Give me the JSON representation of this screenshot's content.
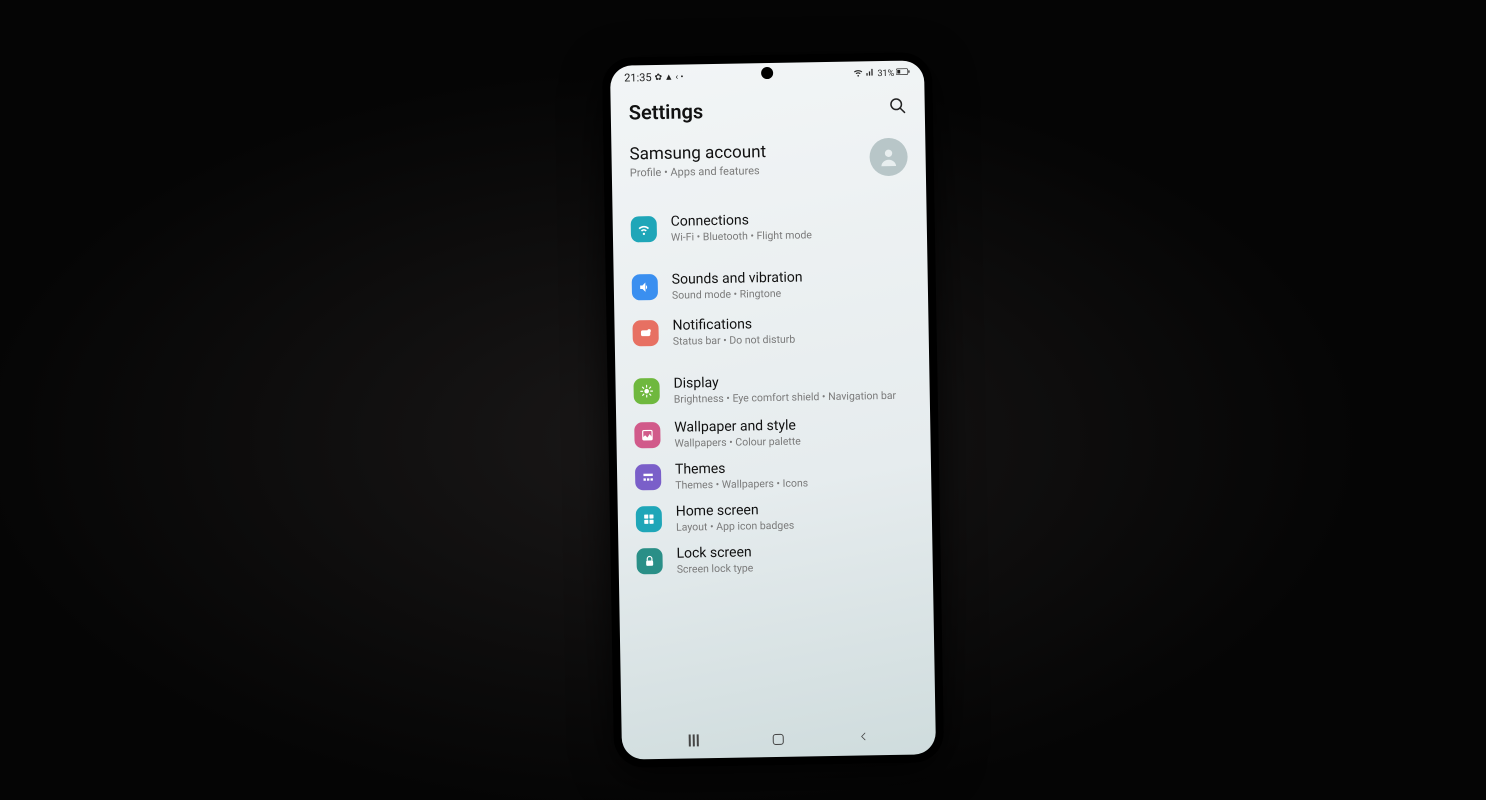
{
  "status": {
    "time": "21:35",
    "battery": "31%"
  },
  "header": {
    "title": "Settings"
  },
  "account": {
    "title": "Samsung account",
    "subtitle": "Profile  •  Apps and features"
  },
  "items": [
    {
      "title": "Connections",
      "subtitle": "Wi-Fi  •  Bluetooth  •  Flight mode",
      "color": "#1fa6b8",
      "icon": "wifi"
    },
    {
      "title": "Sounds and vibration",
      "subtitle": "Sound mode  •  Ringtone",
      "color": "#3a8ff0",
      "icon": "sound"
    },
    {
      "title": "Notifications",
      "subtitle": "Status bar  •  Do not disturb",
      "color": "#e77062",
      "icon": "notification"
    },
    {
      "title": "Display",
      "subtitle": "Brightness  •  Eye comfort shield  •  Navigation bar",
      "color": "#6fb83e",
      "icon": "display"
    },
    {
      "title": "Wallpaper and style",
      "subtitle": "Wallpapers  •  Colour palette",
      "color": "#d15a8a",
      "icon": "wallpaper"
    },
    {
      "title": "Themes",
      "subtitle": "Themes  •  Wallpapers  •  Icons",
      "color": "#7a5fc9",
      "icon": "themes"
    },
    {
      "title": "Home screen",
      "subtitle": "Layout  •  App icon badges",
      "color": "#1fa6b8",
      "icon": "home"
    },
    {
      "title": "Lock screen",
      "subtitle": "Screen lock type",
      "color": "#2a8f87",
      "icon": "lock"
    }
  ]
}
